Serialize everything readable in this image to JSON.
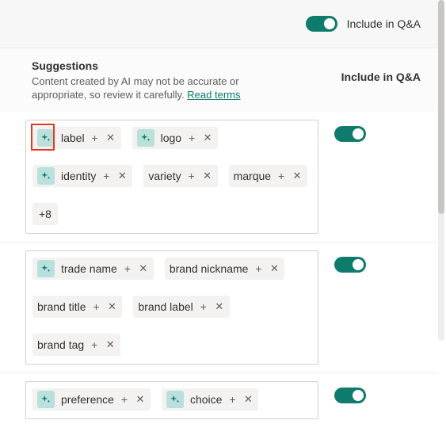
{
  "colors": {
    "accent": "#0f7b6c",
    "sparkle_bg": "#b9e0da",
    "chip_bg": "#f3f2f1",
    "highlight": "#e8361e"
  },
  "top": {
    "include_label": "Include in Q&A",
    "include_on": true
  },
  "header": {
    "title": "Suggestions",
    "desc_prefix": "Content created by AI may not be accurate or appropriate, so review it carefully. ",
    "read_terms": "Read terms",
    "column_label": "Include in Q&A"
  },
  "groups": [
    {
      "toggle_on": true,
      "chips": [
        {
          "label": "label",
          "ai": true
        },
        {
          "label": "logo",
          "ai": true
        },
        {
          "label": "identity",
          "ai": true
        },
        {
          "label": "variety",
          "ai": false
        },
        {
          "label": "marque",
          "ai": false
        }
      ],
      "overflow": "+8"
    },
    {
      "toggle_on": true,
      "chips": [
        {
          "label": "trade name",
          "ai": true
        },
        {
          "label": "brand nickname",
          "ai": false
        },
        {
          "label": "brand title",
          "ai": false
        },
        {
          "label": "brand label",
          "ai": false
        },
        {
          "label": "brand tag",
          "ai": false
        }
      ],
      "overflow": null
    },
    {
      "toggle_on": true,
      "chips": [
        {
          "label": "preference",
          "ai": true
        },
        {
          "label": "choice",
          "ai": true
        }
      ],
      "overflow": null
    }
  ]
}
